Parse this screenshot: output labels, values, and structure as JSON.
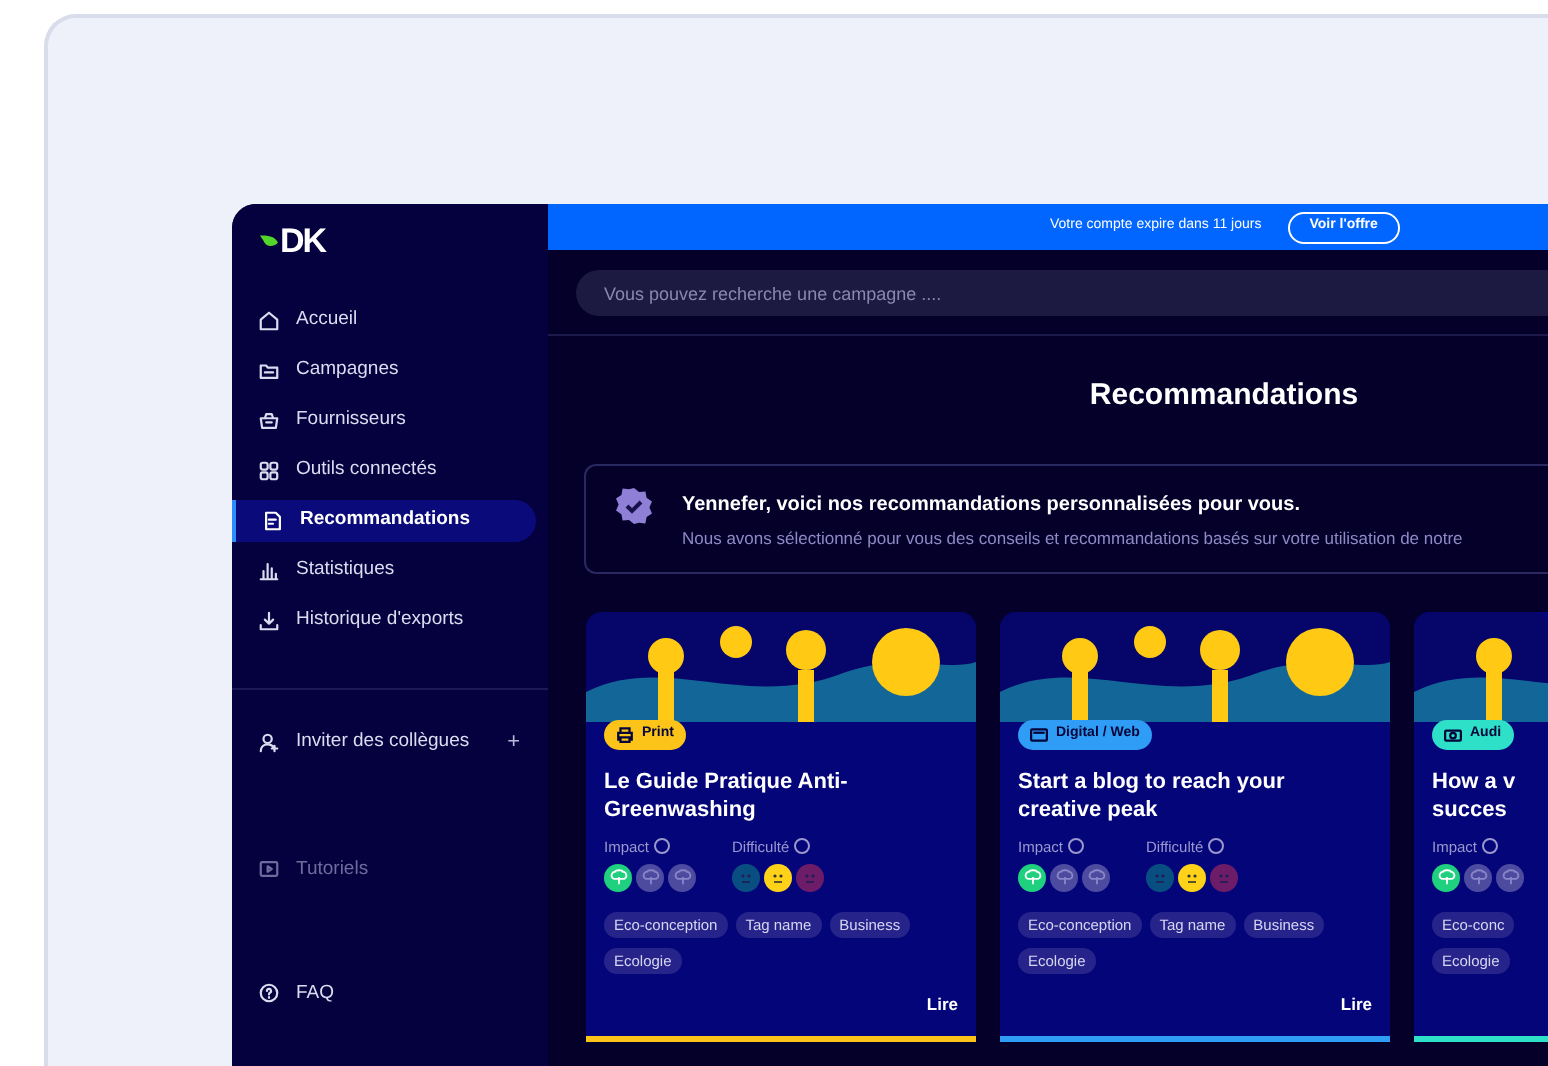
{
  "sidebar": {
    "logo": "DK",
    "items": [
      {
        "label": "Accueil",
        "selected": false
      },
      {
        "label": "Campagnes",
        "selected": false
      },
      {
        "label": "Fournisseurs",
        "selected": false
      },
      {
        "label": "Outils connectés",
        "selected": false
      },
      {
        "label": "Recommandations",
        "selected": true
      },
      {
        "label": "Statistiques",
        "selected": false
      },
      {
        "label": "Historique d'exports",
        "selected": false
      }
    ],
    "invite": {
      "label": "Inviter des collègues",
      "action": "+"
    },
    "footer_items": [
      {
        "label": "Tutoriels",
        "disabled": true
      },
      {
        "label": "FAQ",
        "disabled": false
      }
    ]
  },
  "topbar": {
    "notice": "Votre compte expire dans 11 jours",
    "button": "Voir l'offre"
  },
  "search": {
    "placeholder": "Vous pouvez recherche une campagne ...."
  },
  "page_title": "Recommandations",
  "banner": {
    "title": "Yennefer, voici nos recommandations personnalisées pour vous.",
    "text": "Nous avons sélectionné pour vous des conseils et recommandations basés sur votre utilisation de notre"
  },
  "cards": [
    {
      "badge": "Print",
      "color": "#fcc419",
      "title": "Le Guide Pratique Anti-Greenwashing",
      "impact_label": "Impact",
      "difficulty_label": "Difficulté",
      "impact": [
        {
          "on": true
        },
        {
          "on": false
        },
        {
          "on": false
        }
      ],
      "difficulty": [
        {
          "kind": "easy",
          "on": false
        },
        {
          "kind": "medium",
          "on": true
        },
        {
          "kind": "hard",
          "on": false
        }
      ],
      "tags": [
        "Eco-conception",
        "Tag name",
        "Business",
        "Ecologie"
      ],
      "action": "Lire"
    },
    {
      "badge": "Digital / Web",
      "color": "#2f9cf5",
      "title": "Start a blog to reach your creative peak",
      "impact_label": "Impact",
      "difficulty_label": "Difficulté",
      "impact": [
        {
          "on": true
        },
        {
          "on": false
        },
        {
          "on": false
        }
      ],
      "difficulty": [
        {
          "kind": "easy",
          "on": false
        },
        {
          "kind": "medium",
          "on": true
        },
        {
          "kind": "hard",
          "on": false
        }
      ],
      "tags": [
        "Eco-conception",
        "Tag name",
        "Business",
        "Ecologie"
      ],
      "action": "Lire"
    },
    {
      "badge": "Audi",
      "color": "#2ee0c8",
      "title": "How a v succes",
      "impact_label": "Impact",
      "impact": [
        {
          "on": true
        },
        {
          "on": false
        },
        {
          "on": false
        }
      ],
      "tags": [
        "Eco-conc",
        "Ecologie"
      ]
    }
  ]
}
